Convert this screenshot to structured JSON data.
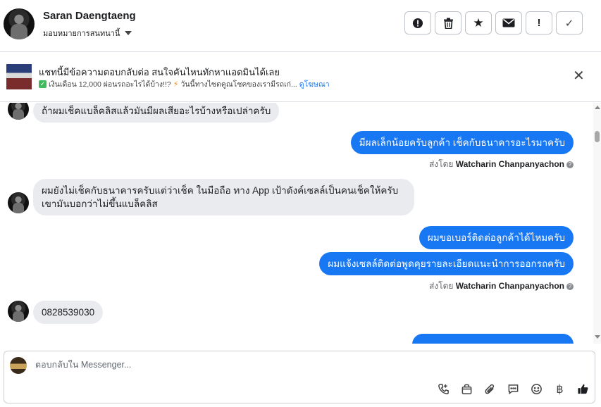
{
  "header": {
    "contact_name": "Saran Daengtaeng",
    "assign_label": "มอบหมายการสนทนานี้",
    "actions": [
      {
        "icon": "alert-circle-icon",
        "glyph": "❗"
      },
      {
        "icon": "trash-icon",
        "glyph": "🗑"
      },
      {
        "icon": "star-icon",
        "glyph": "★"
      },
      {
        "icon": "mail-icon",
        "glyph": "✉"
      },
      {
        "icon": "exclamation-icon",
        "glyph": "!"
      },
      {
        "icon": "check-icon",
        "glyph": "✓"
      }
    ]
  },
  "ad": {
    "title": "แชทนี้มีข้อความตอบกลับต่อ สนใจคันไหนทักหาแอดมินได้เลย",
    "line1": "เงินเดือน 12,000 ผ่อนรถอะไรได้บ้าง!!?",
    "line2": "วันนี้ทางไซตคูณโชคของเรามีรถเก่...",
    "link": "ดูโฆษณา",
    "close": "✕"
  },
  "messages": {
    "m1": "ถ้าผมเช็คแบล็คลิสแล้วมันมีผลเสียอะไรบ้างหรือเปล่าครับ",
    "m2": "มีผลเล็กน้อยครับลูกค้า เช็คกับธนาคารอะไรมาครับ",
    "sent_by_label": "ส่งโดย",
    "agent_name": "Watcharin Chanpanyachon",
    "m3_line1": "ผมยังไม่เช็คกับธนาคารครับแต่ว่าเช็ค ในมือถือ ทาง App เป้าดังค์เซลล์เป็นคนเช็คให้ครับ",
    "m3_line2": "เขามันบอกว่าไม่ขึ้นแบล็คลิส",
    "m4": "ผมขอเบอร์ติดต่อลูกค้าได้ไหมครับ",
    "m5": "ผมแจ้งเซลล์ติดต่อพูดคุยรายละเอียดแนะนำการออกรถครับ",
    "m6": "0828539030"
  },
  "composer": {
    "placeholder": "ตอบกลับใน Messenger...",
    "tools": [
      "phone-icon",
      "bag-icon",
      "paperclip-icon",
      "chat-icon",
      "emoji-icon",
      "baht-icon",
      "thumbs-up-icon"
    ],
    "baht_glyph": "฿"
  }
}
